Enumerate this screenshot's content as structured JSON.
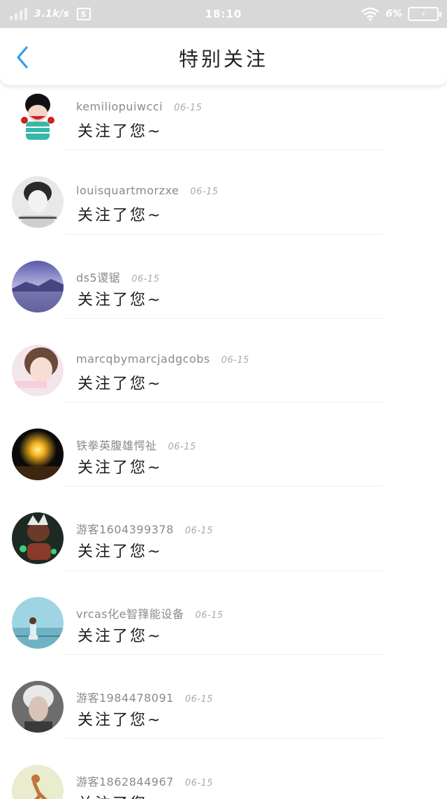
{
  "status_bar": {
    "net_speed": "3.1k/s",
    "time": "18:10",
    "battery_percent": "6%"
  },
  "header": {
    "title": "特别关注"
  },
  "followers": [
    {
      "name": "kemiliopuiwcci",
      "date": "06-15",
      "message": "关注了您~"
    },
    {
      "name": "louisquartmorzxe",
      "date": "06-15",
      "message": "关注了您~"
    },
    {
      "name": "ds5谡锯",
      "date": "06-15",
      "message": "关注了您~"
    },
    {
      "name": "marcqbymarcjadgcobs",
      "date": "06-15",
      "message": "关注了您~"
    },
    {
      "name": "铁拳英腹雄愕祉",
      "date": "06-15",
      "message": "关注了您~"
    },
    {
      "name": "游客1604399378",
      "date": "06-15",
      "message": "关注了您~"
    },
    {
      "name": "vrcas化e智箨能设备",
      "date": "06-15",
      "message": "关注了您~"
    },
    {
      "name": "游客1984478091",
      "date": "06-15",
      "message": "关注了您~"
    },
    {
      "name": "游客1862844967",
      "date": "06-15",
      "message": "关注了您~"
    }
  ],
  "colors": {
    "status_bar_bg": "#d8d8d8",
    "accent_back_arrow": "#2a9df4",
    "username_gray": "#8a8a8a",
    "date_gray": "#aaaaaa"
  }
}
